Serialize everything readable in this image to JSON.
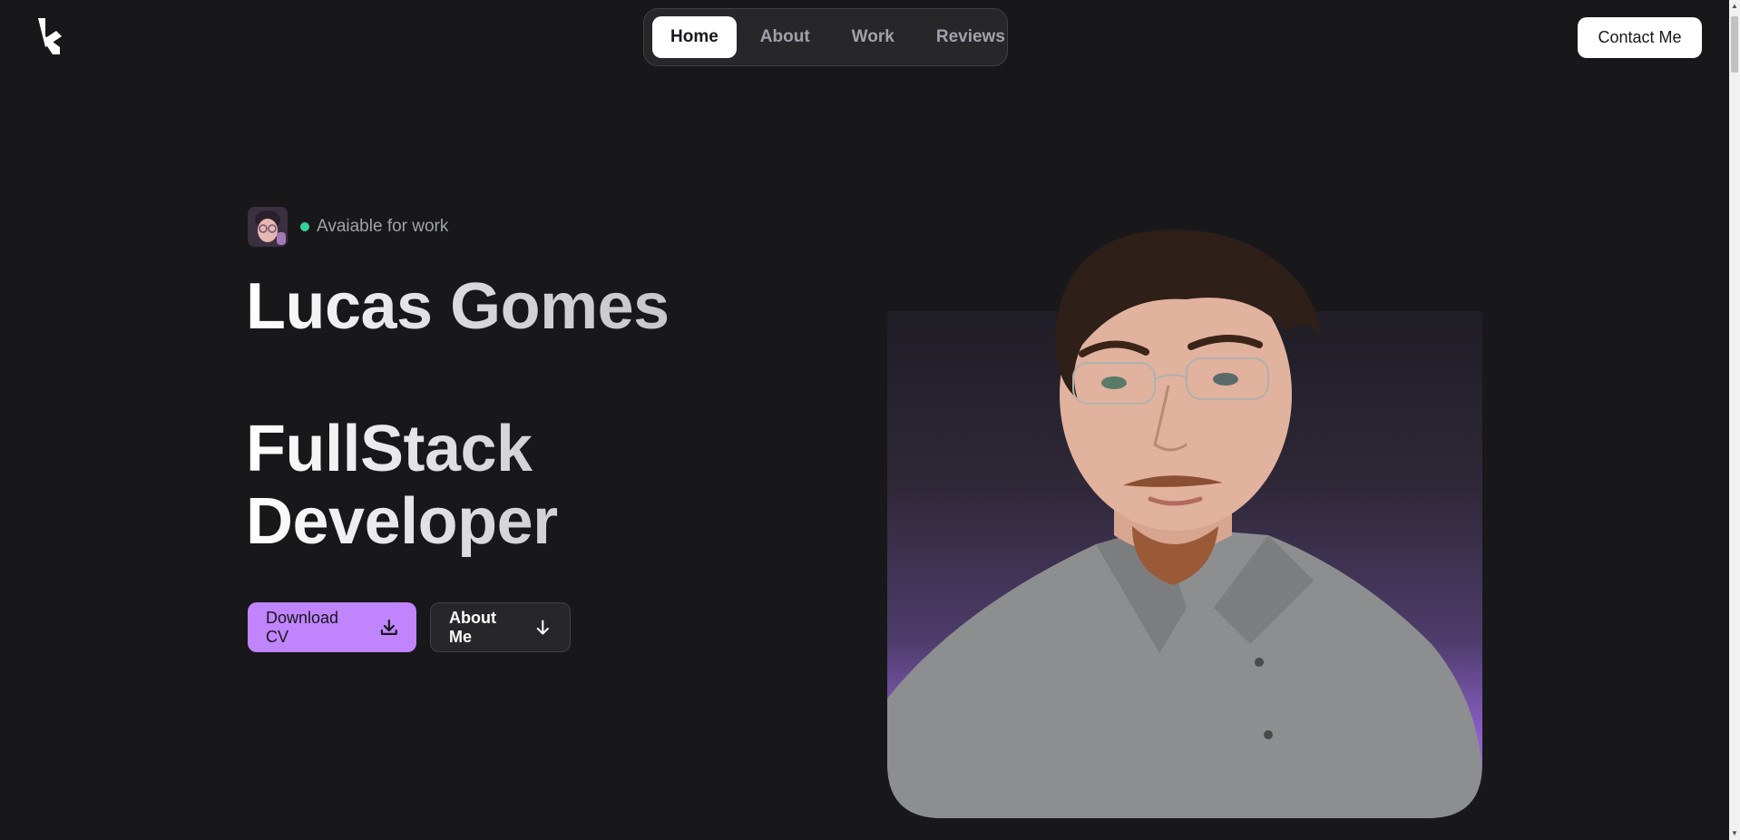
{
  "header": {
    "logo_icon": "k-logo-icon",
    "nav": {
      "items": [
        {
          "label": "Home",
          "active": true
        },
        {
          "label": "About",
          "active": false
        },
        {
          "label": "Work",
          "active": false
        },
        {
          "label": "Reviews",
          "active": false
        }
      ]
    },
    "contact_label": "Contact Me"
  },
  "hero": {
    "status_text": "Avaiable for work",
    "status_color": "#34d399",
    "name": "Lucas Gomes",
    "role_line1": "FullStack",
    "role_line2": "Developer",
    "download_label": "Download CV",
    "download_icon": "download-icon",
    "about_label": "About Me",
    "about_icon": "arrow-down-icon"
  },
  "colors": {
    "background": "#18181b",
    "accent": "#c084fc",
    "nav_bg": "#27272a"
  }
}
